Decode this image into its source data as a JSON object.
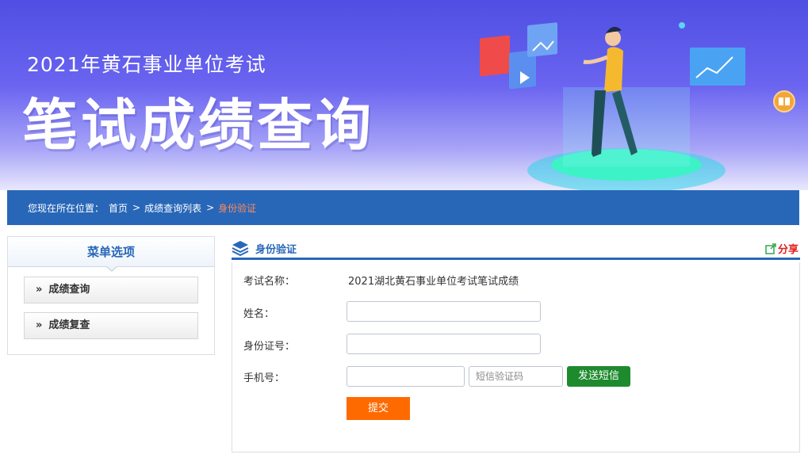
{
  "banner": {
    "subtitle": "2021年黄石事业单位考试",
    "title": "笔试成绩查询"
  },
  "breadcrumb": {
    "prefix": "您现在所在位置：",
    "items": [
      "首页",
      "成绩查询列表",
      "身份验证"
    ],
    "separator": ">"
  },
  "sidebar": {
    "title": "菜单选项",
    "items": [
      {
        "label": "成绩查询",
        "chevron": "»"
      },
      {
        "label": "成绩复查",
        "chevron": "»"
      }
    ]
  },
  "panel": {
    "title": "身份验证",
    "share_label": "分享"
  },
  "form": {
    "exam_label": "考试名称：",
    "exam_value": "2021湖北黄石事业单位考试笔试成绩",
    "name_label": "姓名：",
    "name_value": "",
    "id_label": "身份证号：",
    "id_value": "",
    "phone_label": "手机号：",
    "phone_value": "",
    "sms_placeholder": "短信验证码",
    "send_sms_label": "发送短信",
    "submit_label": "提交"
  },
  "colors": {
    "primary": "#2867b8",
    "current_crumb": "#ff8a5c",
    "send_button": "#1e8a2e",
    "submit_button": "#ff6a00",
    "share": "#e02020"
  },
  "icons": [
    "layers-icon",
    "share-icon",
    "book-icon",
    "chevron-right-icon"
  ]
}
